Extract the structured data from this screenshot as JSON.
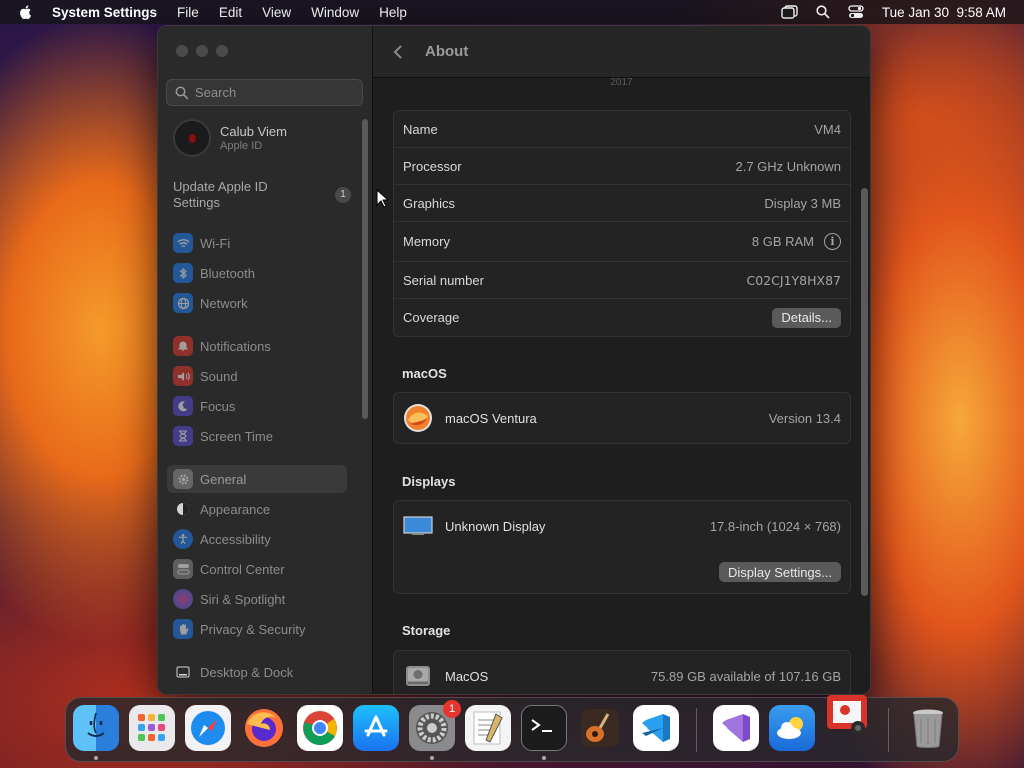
{
  "menubar": {
    "app_name": "System Settings",
    "items": [
      "File",
      "Edit",
      "View",
      "Window",
      "Help"
    ],
    "clock": "Tue Jan 30  9:58 AM"
  },
  "sidebar": {
    "search_placeholder": "Search",
    "account_name": "Calub Viem",
    "account_sub": "Apple ID",
    "update_text": "Update Apple ID Settings",
    "update_badge": "1",
    "items": [
      {
        "label": "Wi-Fi",
        "icon": "wifi-icon",
        "color": "#1e7cf0"
      },
      {
        "label": "Bluetooth",
        "icon": "bluetooth-icon",
        "color": "#1e7cf0"
      },
      {
        "label": "Network",
        "icon": "globe-icon",
        "color": "#1e7cf0"
      },
      {
        "label": "Notifications",
        "icon": "bell-icon",
        "color": "#e5352c"
      },
      {
        "label": "Sound",
        "icon": "speaker-icon",
        "color": "#e5352c"
      },
      {
        "label": "Focus",
        "icon": "moon-icon",
        "color": "#5b4bd6"
      },
      {
        "label": "Screen Time",
        "icon": "hourglass-icon",
        "color": "#5b4bd6"
      },
      {
        "label": "General",
        "icon": "gear-icon",
        "color": "#8a8a8a"
      },
      {
        "label": "Appearance",
        "icon": "appearance-icon",
        "color": "#2a2a2a"
      },
      {
        "label": "Accessibility",
        "icon": "accessibility-icon",
        "color": "#1e7cf0"
      },
      {
        "label": "Control Center",
        "icon": "control-center-icon",
        "color": "#8a8a8a"
      },
      {
        "label": "Siri & Spotlight",
        "icon": "siri-icon",
        "color": "#b03fc0"
      },
      {
        "label": "Privacy & Security",
        "icon": "hand-icon",
        "color": "#1e7cf0"
      },
      {
        "label": "Desktop & Dock",
        "icon": "dock-icon",
        "color": "#2a2a2a"
      }
    ]
  },
  "content": {
    "title": "About",
    "year": "2017",
    "info": [
      {
        "key": "Name",
        "value": "VM4"
      },
      {
        "key": "Processor",
        "value": "2.7 GHz Unknown"
      },
      {
        "key": "Graphics",
        "value": "Display 3 MB"
      },
      {
        "key": "Memory",
        "value": "8 GB RAM"
      },
      {
        "key": "Serial number",
        "value": "C02CJ1Y8HX87"
      },
      {
        "key": "Coverage",
        "value": "Details..."
      }
    ],
    "macos_header": "macOS",
    "macos_name": "macOS Ventura",
    "macos_version": "Version 13.4",
    "displays_header": "Displays",
    "display_name": "Unknown Display",
    "display_size": "17.8-inch (1024 × 768)",
    "display_settings_btn": "Display Settings...",
    "storage_header": "Storage",
    "storage_name": "MacOS",
    "storage_value": "75.89 GB available of 107.16 GB"
  },
  "dock": {
    "settings_badge": "1",
    "apps": [
      "Finder",
      "Launchpad",
      "Safari",
      "Firefox",
      "Chrome",
      "App Store",
      "System Settings",
      "TextEdit",
      "Terminal",
      "GarageBand",
      "Visual Studio Code",
      "Visual Studio",
      "Weather",
      "Photo Booth",
      "Trash"
    ]
  }
}
